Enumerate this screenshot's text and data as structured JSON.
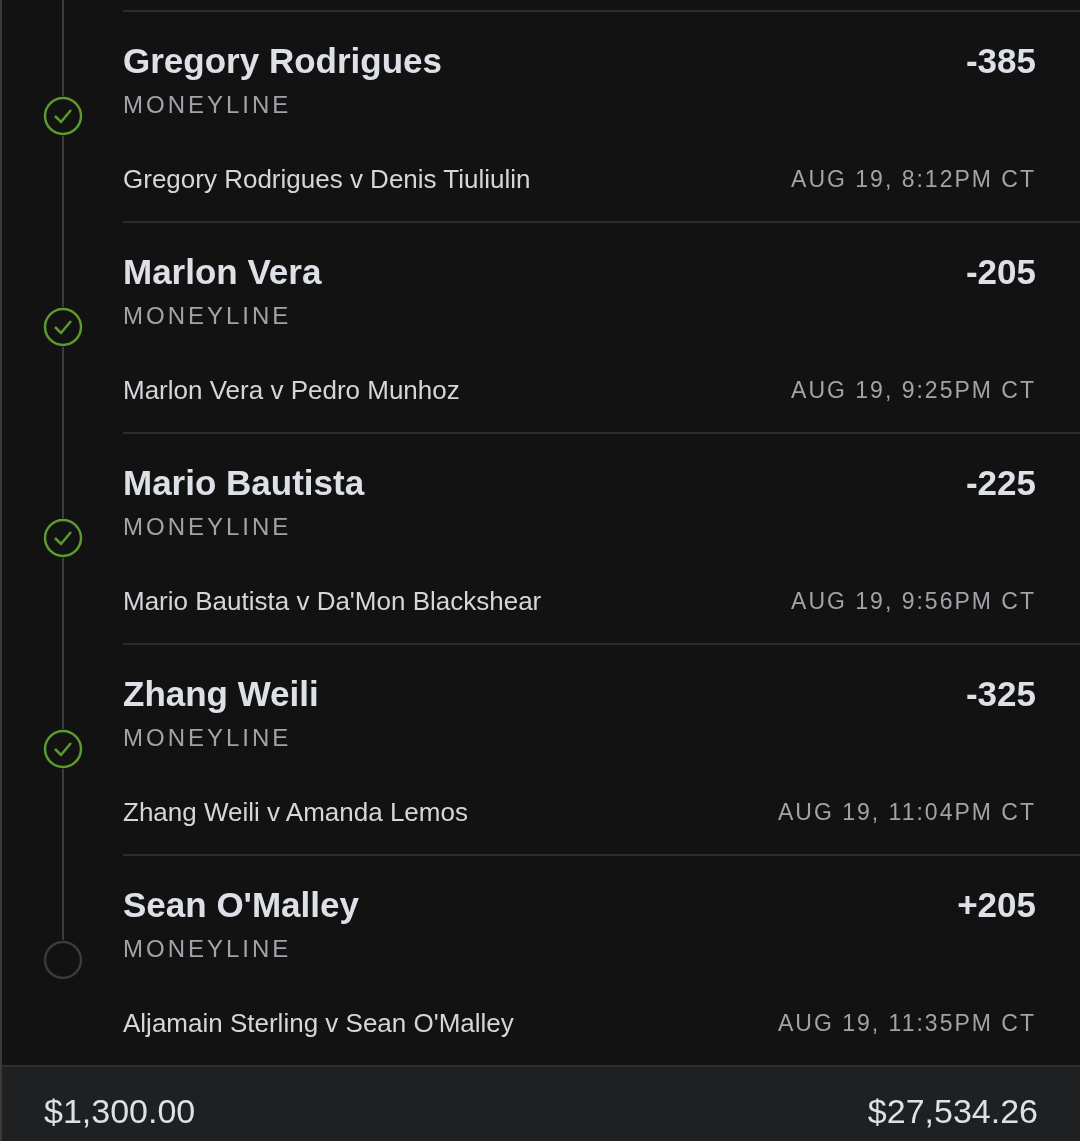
{
  "legs": [
    {
      "selection": "Gregory Rodrigues",
      "market": "MONEYLINE",
      "odds": "-385",
      "matchup": "Gregory Rodrigues v Denis Tiuliulin",
      "time": "AUG 19, 8:12PM CT",
      "won": true
    },
    {
      "selection": "Marlon Vera",
      "market": "MONEYLINE",
      "odds": "-205",
      "matchup": "Marlon Vera v Pedro Munhoz",
      "time": "AUG 19, 9:25PM CT",
      "won": true
    },
    {
      "selection": "Mario Bautista",
      "market": "MONEYLINE",
      "odds": "-225",
      "matchup": "Mario Bautista v Da'Mon Blackshear",
      "time": "AUG 19, 9:56PM CT",
      "won": true
    },
    {
      "selection": "Zhang Weili",
      "market": "MONEYLINE",
      "odds": "-325",
      "matchup": "Zhang Weili v Amanda Lemos",
      "time": "AUG 19, 11:04PM CT",
      "won": true
    },
    {
      "selection": "Sean O'Malley",
      "market": "MONEYLINE",
      "odds": "+205",
      "matchup": "Aljamain Sterling v Sean O'Malley",
      "time": "AUG 19, 11:35PM CT",
      "won": false
    }
  ],
  "footer": {
    "total_wager": "$1,300.00",
    "total_payout": "$27,534.26"
  }
}
